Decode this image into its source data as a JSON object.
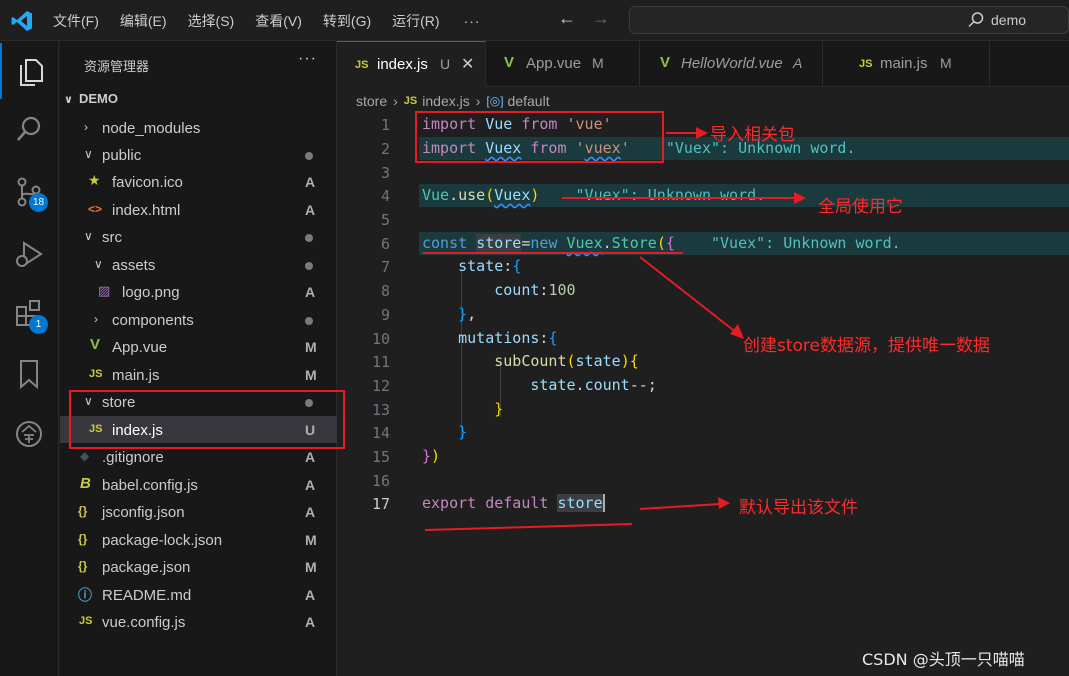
{
  "menu": [
    "文件(F)",
    "编辑(E)",
    "选择(S)",
    "查看(V)",
    "转到(G)",
    "运行(R)",
    "···"
  ],
  "search": {
    "text": "demo"
  },
  "activity": {
    "source_control_badge": "18",
    "extensions_badge": "1"
  },
  "explorer": {
    "title": "资源管理器",
    "more": "···",
    "root": "DEMO",
    "items": [
      {
        "name": "node_modules",
        "status": ""
      },
      {
        "name": "public",
        "status": "dot"
      },
      {
        "name": "favicon.ico",
        "status": "A"
      },
      {
        "name": "index.html",
        "status": "A"
      },
      {
        "name": "src",
        "status": "dot"
      },
      {
        "name": "assets",
        "status": "dot"
      },
      {
        "name": "logo.png",
        "status": "A"
      },
      {
        "name": "components",
        "status": "dot"
      },
      {
        "name": "App.vue",
        "status": "M"
      },
      {
        "name": "main.js",
        "status": "M"
      },
      {
        "name": "store",
        "status": "dot"
      },
      {
        "name": "index.js",
        "status": "U"
      },
      {
        "name": ".gitignore",
        "status": "A"
      },
      {
        "name": "babel.config.js",
        "status": "A"
      },
      {
        "name": "jsconfig.json",
        "status": "A"
      },
      {
        "name": "package-lock.json",
        "status": "M"
      },
      {
        "name": "package.json",
        "status": "M"
      },
      {
        "name": "README.md",
        "status": "A"
      },
      {
        "name": "vue.config.js",
        "status": "A"
      }
    ]
  },
  "tabs": [
    {
      "label": "index.js",
      "status": "U",
      "icon": "JS"
    },
    {
      "label": "App.vue",
      "status": "M",
      "icon": "V"
    },
    {
      "label": "HelloWorld.vue",
      "status": "A",
      "icon": "V"
    },
    {
      "label": "main.js",
      "status": "M",
      "icon": "JS"
    }
  ],
  "breadcrumb": {
    "folder": "store",
    "file": "index.js",
    "symbol": "default"
  },
  "editor": {
    "line_numbers": [
      "1",
      "2",
      "3",
      "4",
      "5",
      "6",
      "7",
      "8",
      "9",
      "10",
      "11",
      "12",
      "13",
      "14",
      "15",
      "16",
      "17"
    ],
    "diagnostic": "\"Vuex\": Unknown word."
  },
  "annotations": {
    "import": "导入相关包",
    "global": "全局使用它",
    "store": "创建store数据源，提供唯一数据",
    "export": "默认导出该文件"
  },
  "watermark": "CSDN @头顶一只喵喵",
  "colors": {
    "accent": "#0078d4",
    "annotation_red": "#e51c23",
    "editor_bg": "#1f1f1f"
  }
}
